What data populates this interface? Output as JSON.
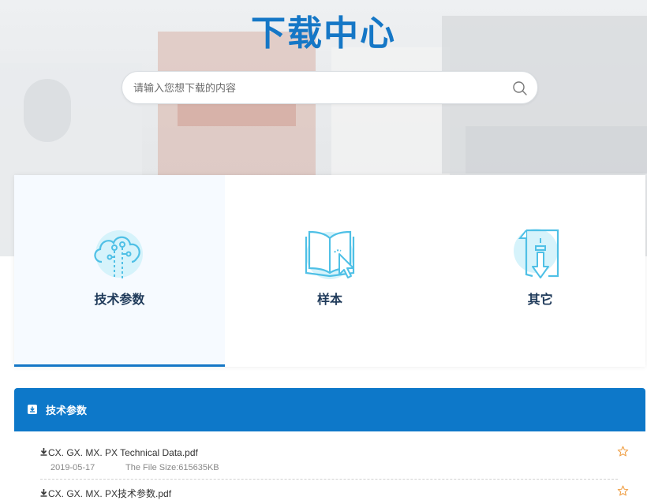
{
  "page_title": "下载中心",
  "search": {
    "placeholder": "请输入您想下载的内容"
  },
  "categories": [
    {
      "label": "技术参数",
      "icon": "cloud-circuit-icon",
      "active": true
    },
    {
      "label": "样本",
      "icon": "book-cursor-icon",
      "active": false
    },
    {
      "label": "其它",
      "icon": "file-download-icon",
      "active": false
    }
  ],
  "list": {
    "title": "技术参数",
    "items": [
      {
        "name": "CX. GX. MX. PX Technical Data.pdf",
        "date": "2019-05-17",
        "size": "The File Size:615635KB"
      },
      {
        "name": "CX. GX. MX. PX技术参数.pdf"
      }
    ]
  },
  "colors": {
    "accent": "#1577c6",
    "header_bar": "#0d78c9",
    "icon_light": "#7fd3ee",
    "star": "#f0a24a"
  }
}
